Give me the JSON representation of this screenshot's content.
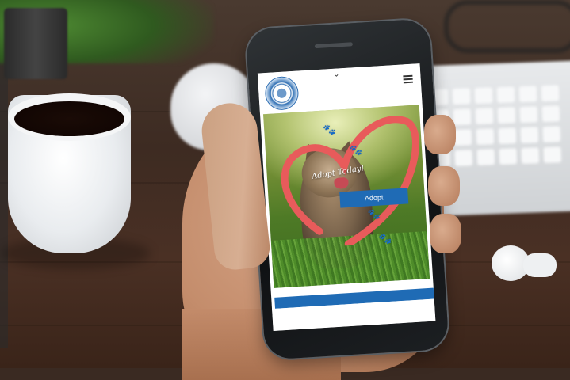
{
  "scene": {
    "objects": [
      "plant",
      "coffee-cup",
      "mouse",
      "keyboard",
      "glasses",
      "earbuds",
      "hand",
      "smartphone"
    ]
  },
  "phone_site": {
    "logo": "site-logo",
    "nav_chevron": "⌄",
    "hero": {
      "tagline": "Adopt Today!",
      "adopt_button": "Adopt",
      "heart_color": "#e85b5b",
      "paw_icon": "paw-icon"
    },
    "accent_color": "#1f6bb5"
  }
}
